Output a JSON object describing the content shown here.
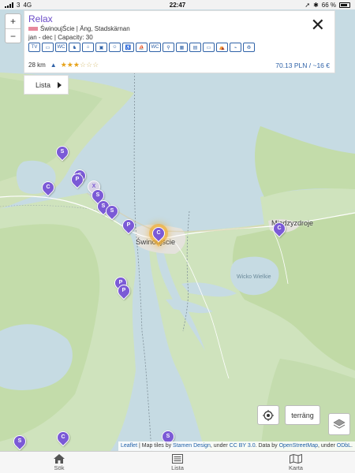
{
  "status_bar": {
    "signal": "3",
    "network": "4G",
    "time": "22:47",
    "battery": "66 %"
  },
  "zoom": {
    "in": "+",
    "out": "−"
  },
  "panel": {
    "title": "Relax",
    "location": "ŚwinoujŚcie | Äng, Stadskärnan",
    "season": "jan - dec | Capacity: 30",
    "facility_icons": [
      "TV",
      "▭",
      "WC",
      "♞",
      "⌂",
      "▣",
      "☺",
      "♿",
      "⛵",
      "WC",
      "⚲",
      "▦",
      "▤",
      "▭",
      "⛺",
      "⌁",
      "♻"
    ],
    "distance": "28 km",
    "rating": 3,
    "rating_max": 6,
    "price": "70.13 PLN / ~16 €",
    "close": "✕"
  },
  "lista_button": "Lista",
  "map": {
    "labels": {
      "city": "Świnoujście",
      "town": "Międzyzdroje",
      "lake": "Wicko Wielkie"
    },
    "markers": [
      {
        "letter": "S",
        "type": "s"
      },
      {
        "letter": "S",
        "type": "s"
      },
      {
        "letter": "C",
        "type": "c"
      },
      {
        "letter": "P",
        "type": "p"
      },
      {
        "letter": "X",
        "type": "x"
      },
      {
        "letter": "S",
        "type": "s"
      },
      {
        "letter": "S",
        "type": "s"
      },
      {
        "letter": "S",
        "type": "s"
      },
      {
        "letter": "P",
        "type": "p"
      },
      {
        "letter": "C",
        "type": "c"
      },
      {
        "letter": "C",
        "type": "c"
      },
      {
        "letter": "P",
        "type": "p"
      },
      {
        "letter": "P",
        "type": "p"
      },
      {
        "letter": "S",
        "type": "s"
      },
      {
        "letter": "C",
        "type": "c"
      },
      {
        "letter": "S",
        "type": "s"
      }
    ]
  },
  "controls": {
    "terrain": "terräng"
  },
  "attribution": {
    "leaflet": "Leaflet",
    "tiles": " | Map tiles by ",
    "stamen": "Stamen Design",
    "under1": ", under ",
    "cc": "CC BY 3.0",
    "data": ". Data by ",
    "osm": "OpenStreetMap",
    "under2": ", under ",
    "odbl": "ODbL",
    "end": "."
  },
  "tabs": [
    {
      "label": "Sök",
      "icon": "home-icon"
    },
    {
      "label": "Lista",
      "icon": "list-icon"
    },
    {
      "label": "Karta",
      "icon": "map-icon"
    }
  ]
}
